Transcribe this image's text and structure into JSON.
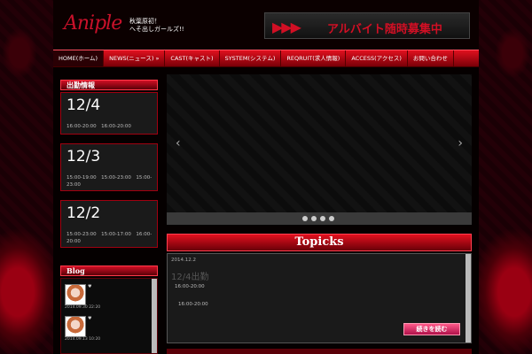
{
  "header": {
    "logo": "Aniple",
    "logo_sub": "",
    "tagline": [
      "秋葉原初！",
      "へそ出しガールズ!!"
    ],
    "banner_arrows": "▶▶▶",
    "banner_text": "アルバイト随時募集中"
  },
  "nav": {
    "items": [
      {
        "label": "HOME(ホーム)"
      },
      {
        "label": "NEWS(ニュース) »"
      },
      {
        "label": "CAST(キャスト)"
      },
      {
        "label": "SYSTEM(システム)"
      },
      {
        "label": "REQRUIT(求人情報)"
      },
      {
        "label": "ACCESS(アクセス)"
      },
      {
        "label": "お問い合わせ"
      }
    ]
  },
  "sidebar": {
    "shift_title": "出勤情報",
    "shifts": [
      {
        "date": "12/4",
        "times": "16:00-20:00　16:00-20:00"
      },
      {
        "date": "12/3",
        "times": "15:00-19:00　15:00-23:00　15:00-23:00"
      },
      {
        "date": "12/2",
        "times": "15:00-23:00　15:00-17:00　16:00-20:00"
      }
    ],
    "blog_title": "Blog",
    "blog_entries": [
      {
        "date": "2014.09.30 22:20",
        "heart": "♥"
      },
      {
        "date": "2014.09.13 10:20",
        "heart": "♥"
      }
    ]
  },
  "topics": {
    "title": "Topicks",
    "date": "2014.12.2",
    "entry_title": "12/4出勤",
    "lines": [
      "16:00-20:00",
      "16:00-20:00"
    ],
    "read_more": "続きを読む"
  },
  "slider": {
    "prev": "‹",
    "next": "›"
  }
}
